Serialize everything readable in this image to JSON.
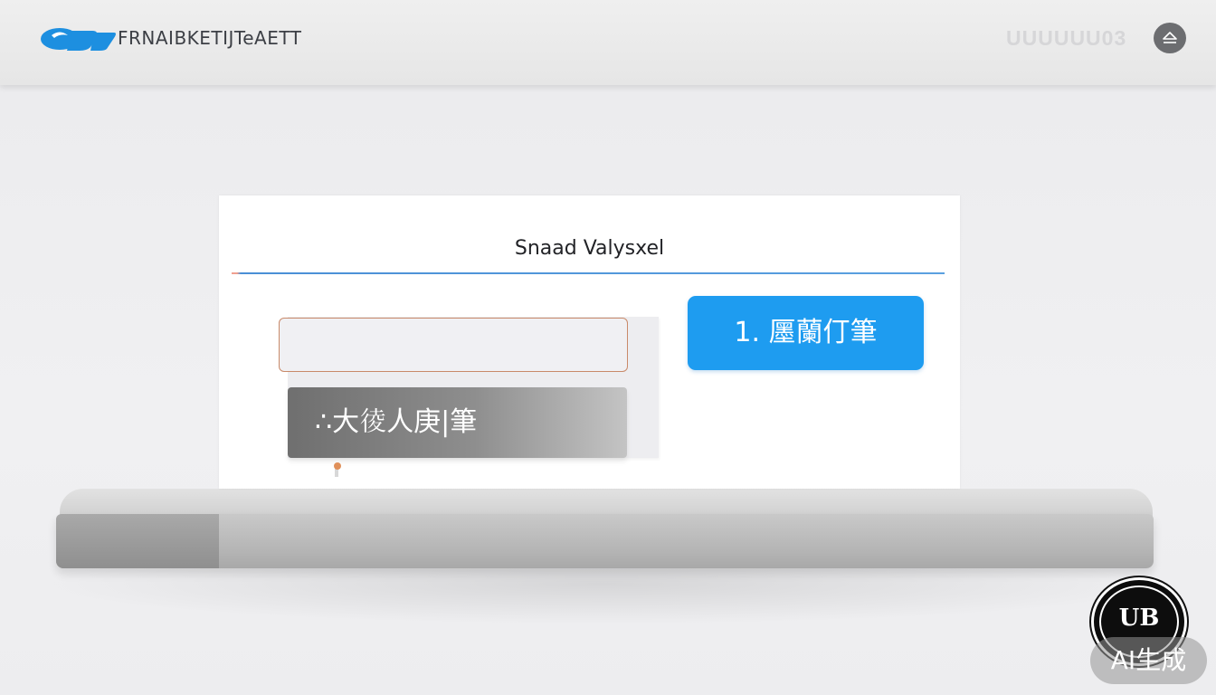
{
  "header": {
    "brand_text": "FRNAIBKETIJTeAETT",
    "right_badge_text": "UUUUUU03",
    "eject_icon": "eject-icon"
  },
  "card": {
    "title": "Snaad Valysxel",
    "input_value": "",
    "primary_button_label": "1. 㕓蘭仃筆",
    "secondary_button_label": "∴大𢔁人庚|筆"
  },
  "watermark": {
    "badge_text": "UB",
    "label": "AI生成"
  },
  "colors": {
    "accent_blue": "#1e9cf0",
    "logo_blue": "#1d8fe0",
    "input_border": "#c98a6a",
    "rule_blue": "#4a8fd6"
  }
}
